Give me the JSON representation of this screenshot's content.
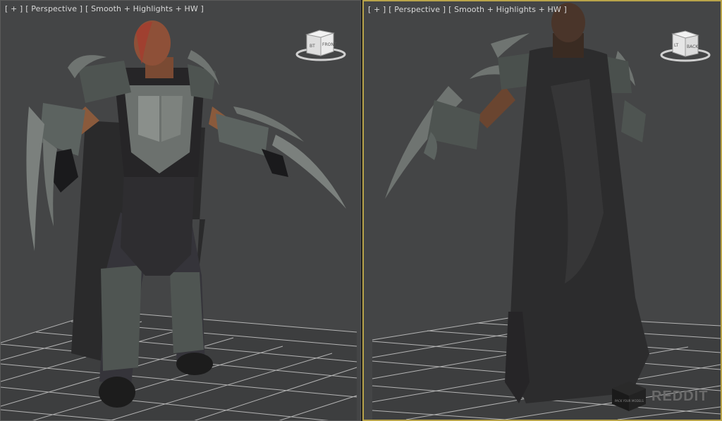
{
  "viewports": [
    {
      "labels": [
        "[ + ]",
        "[ Perspective ]",
        "[ Smooth + Highlights + HW ]"
      ],
      "viewcube_face": "FRONT",
      "viewcube_side": "BT",
      "active": false
    },
    {
      "labels": [
        "[ + ]",
        "[ Perspective ]",
        "[ Smooth + Highlights + HW ]"
      ],
      "viewcube_face": "BACK",
      "viewcube_side": "LT",
      "active": true
    }
  ],
  "watermark": {
    "text": "REDDIT",
    "box_text": "PACK YOUR MODELS"
  },
  "colors": {
    "viewport_bg": "#444546",
    "grid": "#c8c8c8",
    "active_border": "#b9a44a",
    "label": "#d8d8d8"
  },
  "icons": [
    "viewcube-icon",
    "grid-floor",
    "character-model",
    "watermark-logo"
  ]
}
